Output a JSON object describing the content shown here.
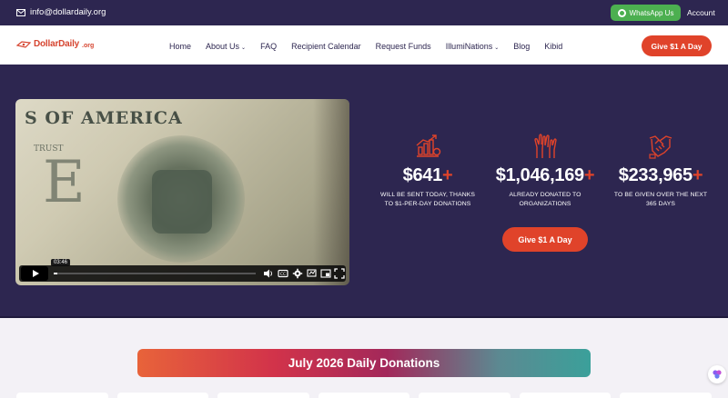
{
  "topbar": {
    "email": "info@dollardaily.org",
    "whatsapp_label": "WhatsApp Us",
    "account_label": "Account"
  },
  "nav": {
    "logo_text": "DollarDaily",
    "logo_tld": ".org",
    "items": [
      {
        "label": "Home",
        "has_dropdown": false
      },
      {
        "label": "About Us",
        "has_dropdown": true
      },
      {
        "label": "FAQ",
        "has_dropdown": false
      },
      {
        "label": "Recipient Calendar",
        "has_dropdown": false
      },
      {
        "label": "Request Funds",
        "has_dropdown": false
      },
      {
        "label": "IllumiNations",
        "has_dropdown": true
      },
      {
        "label": "Blog",
        "has_dropdown": false
      },
      {
        "label": "Kibid",
        "has_dropdown": false
      }
    ],
    "cta_label": "Give $1 A Day"
  },
  "hero": {
    "video": {
      "bill_text": "S OF AMERICA",
      "bill_small_text": "TRUST",
      "timestamp": "03:46",
      "progress": 0.02
    },
    "stats": [
      {
        "value": "$641",
        "suffix": "+",
        "desc_line1": "WILL BE SENT TODAY, THANKS",
        "desc_line2": "TO $1-PER-DAY DONATIONS",
        "icon": "growth-chart-icon"
      },
      {
        "value": "$1,046,169",
        "suffix": "+",
        "desc_line1": "ALREADY DONATED TO",
        "desc_line2": "ORGANIZATIONS",
        "icon": "raised-hands-icon"
      },
      {
        "value": "$233,965",
        "suffix": "+",
        "desc_line1": "TO BE GIVEN OVER THE NEXT",
        "desc_line2": "365 DAYS",
        "icon": "handshake-icon"
      }
    ],
    "cta_label": "Give $1 A Day"
  },
  "donations": {
    "banner_title": "July 2026 Daily Donations"
  },
  "colors": {
    "navy": "#2d2650",
    "accent": "#e0432a",
    "whatsapp": "#4caf50"
  }
}
